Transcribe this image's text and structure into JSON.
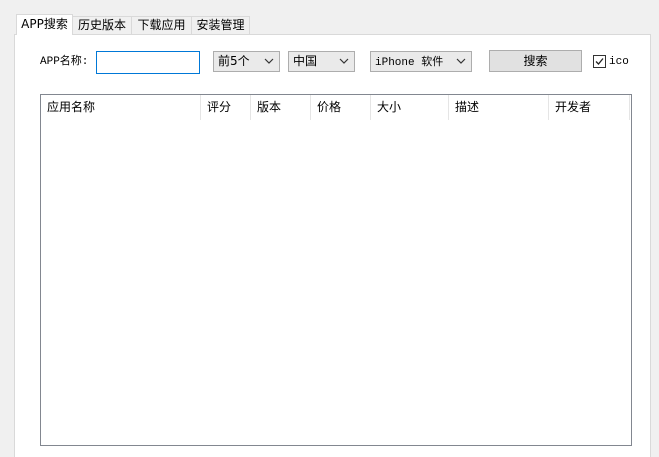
{
  "tabs": [
    {
      "label": "APP搜索",
      "active": true
    },
    {
      "label": "历史版本",
      "active": false
    },
    {
      "label": "下载应用",
      "active": false
    },
    {
      "label": "安装管理",
      "active": false
    }
  ],
  "search": {
    "name_label": "APP名称:",
    "name_value": "",
    "count_select": "前5个",
    "region_select": "中国",
    "type_select": "iPhone 软件",
    "dropdown_icon": "chevron-down-icon",
    "search_button": "搜索",
    "ico_label": "ico",
    "ico_checked": "true"
  },
  "results": {
    "columns": [
      "应用名称",
      "评分",
      "版本",
      "价格",
      "大小",
      "描述",
      "开发者"
    ],
    "rows": []
  },
  "colors": {
    "focus_border": "#0078d7"
  }
}
